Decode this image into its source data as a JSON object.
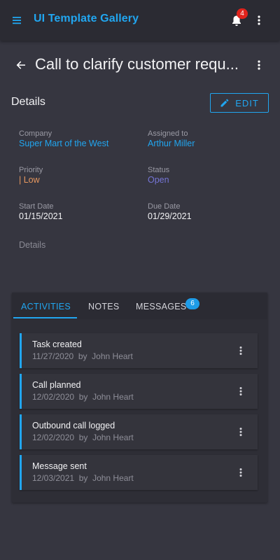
{
  "app": {
    "title": "UI Template Gallery",
    "notifications_count": "4"
  },
  "task": {
    "title": "Call to clarify customer requ..."
  },
  "details": {
    "heading": "Details",
    "edit_label": "EDIT",
    "company_label": "Company",
    "company_value": "Super Mart of the West",
    "assigned_label": "Assigned to",
    "assigned_value": "Arthur Miller",
    "priority_label": "Priority",
    "priority_value": "| Low",
    "status_label": "Status",
    "status_value": "Open",
    "start_label": "Start Date",
    "start_value": "01/15/2021",
    "due_label": "Due Date",
    "due_value": "01/29/2021",
    "notes_label": "Details"
  },
  "tabs": [
    {
      "label": "ACTIVITIES"
    },
    {
      "label": "NOTES"
    },
    {
      "label": "MESSAGES",
      "badge": "6"
    }
  ],
  "activities": [
    {
      "title": "Task created",
      "meta": "11/27/2020  by  John Heart"
    },
    {
      "title": "Call planned",
      "meta": "12/02/2020  by  John Heart"
    },
    {
      "title": "Outbound call logged",
      "meta": "12/02/2020  by  John Heart"
    },
    {
      "title": "Message sent",
      "meta": "12/03/2021  by  John Heart"
    }
  ],
  "colors": {
    "accent": "#21a6f0",
    "badge": "#e0231c",
    "priority_low": "#e5975f",
    "status_open": "#7575d6"
  },
  "icons": [
    "menu-icon",
    "bell-icon",
    "more-vert-icon",
    "arrow-back-icon",
    "pencil-icon"
  ]
}
